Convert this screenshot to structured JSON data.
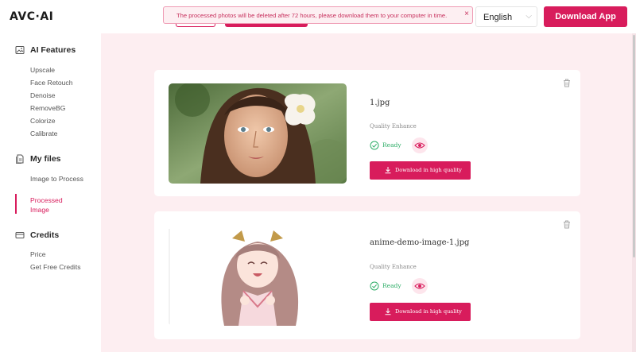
{
  "header": {
    "logo": "AVC·AI",
    "toast": "The processed photos will be deleted after 72 hours, please download them to your computer in time.",
    "toast_close": "×",
    "language": "English",
    "download_app": "Download App"
  },
  "sidebar": {
    "sections": [
      {
        "title": "AI Features",
        "icon": "image-icon",
        "items": [
          "Upscale",
          "Face Retouch",
          "Denoise",
          "RemoveBG",
          "Colorize",
          "Calibrate"
        ]
      },
      {
        "title": "My files",
        "icon": "files-icon",
        "items": [
          "Image to Process",
          "Processed Image"
        ],
        "active": "Processed Image"
      },
      {
        "title": "Credits",
        "icon": "credits-icon",
        "items": [
          "Price",
          "Get Free Credits"
        ]
      }
    ]
  },
  "files": [
    {
      "name": "1.jpg",
      "quality": "Quality Enhance",
      "status": "Ready",
      "download": "Download in high quality"
    },
    {
      "name": "anime-demo-image-1.jpg",
      "quality": "Quality Enhance",
      "status": "Ready",
      "download": "Download in high quality"
    }
  ],
  "colors": {
    "accent": "#d81c5c",
    "ready": "#2fae68",
    "background": "#fdeef1"
  }
}
